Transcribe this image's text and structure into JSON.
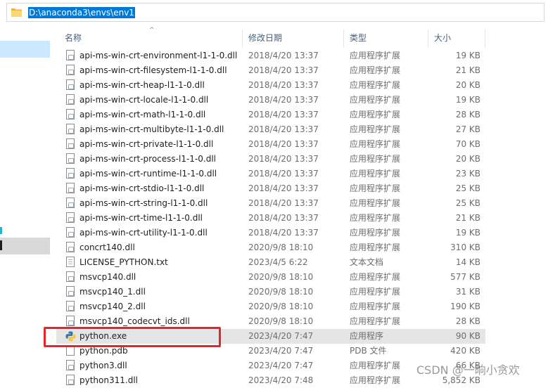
{
  "address": {
    "path": "D:\\anaconda3\\envs\\env1"
  },
  "columns": {
    "name": "名称",
    "date": "修改日期",
    "type": "类型",
    "size": "大小"
  },
  "files": [
    {
      "name": "api-ms-win-crt-environment-l1-1-0.dll",
      "date": "2018/4/20 13:37",
      "type": "应用程序扩展",
      "size": "19 KB",
      "icon": "dll-file-icon"
    },
    {
      "name": "api-ms-win-crt-filesystem-l1-1-0.dll",
      "date": "2018/4/20 13:37",
      "type": "应用程序扩展",
      "size": "21 KB",
      "icon": "dll-file-icon"
    },
    {
      "name": "api-ms-win-crt-heap-l1-1-0.dll",
      "date": "2018/4/20 13:37",
      "type": "应用程序扩展",
      "size": "20 KB",
      "icon": "dll-file-icon"
    },
    {
      "name": "api-ms-win-crt-locale-l1-1-0.dll",
      "date": "2018/4/20 13:37",
      "type": "应用程序扩展",
      "size": "19 KB",
      "icon": "dll-file-icon"
    },
    {
      "name": "api-ms-win-crt-math-l1-1-0.dll",
      "date": "2018/4/20 13:37",
      "type": "应用程序扩展",
      "size": "28 KB",
      "icon": "dll-file-icon"
    },
    {
      "name": "api-ms-win-crt-multibyte-l1-1-0.dll",
      "date": "2018/4/20 13:37",
      "type": "应用程序扩展",
      "size": "27 KB",
      "icon": "dll-file-icon"
    },
    {
      "name": "api-ms-win-crt-private-l1-1-0.dll",
      "date": "2018/4/20 13:37",
      "type": "应用程序扩展",
      "size": "70 KB",
      "icon": "dll-file-icon"
    },
    {
      "name": "api-ms-win-crt-process-l1-1-0.dll",
      "date": "2018/4/20 13:37",
      "type": "应用程序扩展",
      "size": "20 KB",
      "icon": "dll-file-icon"
    },
    {
      "name": "api-ms-win-crt-runtime-l1-1-0.dll",
      "date": "2018/4/20 13:37",
      "type": "应用程序扩展",
      "size": "23 KB",
      "icon": "dll-file-icon"
    },
    {
      "name": "api-ms-win-crt-stdio-l1-1-0.dll",
      "date": "2018/4/20 13:37",
      "type": "应用程序扩展",
      "size": "25 KB",
      "icon": "dll-file-icon"
    },
    {
      "name": "api-ms-win-crt-string-l1-1-0.dll",
      "date": "2018/4/20 13:37",
      "type": "应用程序扩展",
      "size": "25 KB",
      "icon": "dll-file-icon"
    },
    {
      "name": "api-ms-win-crt-time-l1-1-0.dll",
      "date": "2018/4/20 13:37",
      "type": "应用程序扩展",
      "size": "21 KB",
      "icon": "dll-file-icon"
    },
    {
      "name": "api-ms-win-crt-utility-l1-1-0.dll",
      "date": "2018/4/20 13:37",
      "type": "应用程序扩展",
      "size": "19 KB",
      "icon": "dll-file-icon"
    },
    {
      "name": "concrt140.dll",
      "date": "2020/9/8 18:10",
      "type": "应用程序扩展",
      "size": "310 KB",
      "icon": "dll-file-icon"
    },
    {
      "name": "LICENSE_PYTHON.txt",
      "date": "2023/4/5 6:22",
      "type": "文本文档",
      "size": "14 KB",
      "icon": "text-file-icon"
    },
    {
      "name": "msvcp140.dll",
      "date": "2020/9/8 18:10",
      "type": "应用程序扩展",
      "size": "577 KB",
      "icon": "dll-file-icon"
    },
    {
      "name": "msvcp140_1.dll",
      "date": "2020/9/8 18:10",
      "type": "应用程序扩展",
      "size": "31 KB",
      "icon": "dll-file-icon"
    },
    {
      "name": "msvcp140_2.dll",
      "date": "2020/9/8 18:10",
      "type": "应用程序扩展",
      "size": "190 KB",
      "icon": "dll-file-icon"
    },
    {
      "name": "msvcp140_codecvt_ids.dll",
      "date": "2020/9/8 18:10",
      "type": "应用程序扩展",
      "size": "28 KB",
      "icon": "dll-file-icon"
    },
    {
      "name": "python.exe",
      "date": "2023/4/20 7:47",
      "type": "应用程序",
      "size": "90 KB",
      "icon": "python-icon",
      "highlighted": true
    },
    {
      "name": "python.pdb",
      "date": "2023/4/20 7:47",
      "type": "PDB 文件",
      "size": "420 KB",
      "icon": "blank-file-icon"
    },
    {
      "name": "python3.dll",
      "date": "2023/4/20 7:47",
      "type": "应用程序扩展",
      "size": "66 KB",
      "icon": "dll-file-icon"
    },
    {
      "name": "python311.dll",
      "date": "2023/4/20 7:48",
      "type": "应用程序扩展",
      "size": "5,852 KB",
      "icon": "dll-file-icon"
    }
  ],
  "watermark": "CSDN @一晌小贪欢",
  "colors": {
    "selection": "#0078d7",
    "annotation": "#e8242b",
    "hover": "#e5e5e5"
  }
}
